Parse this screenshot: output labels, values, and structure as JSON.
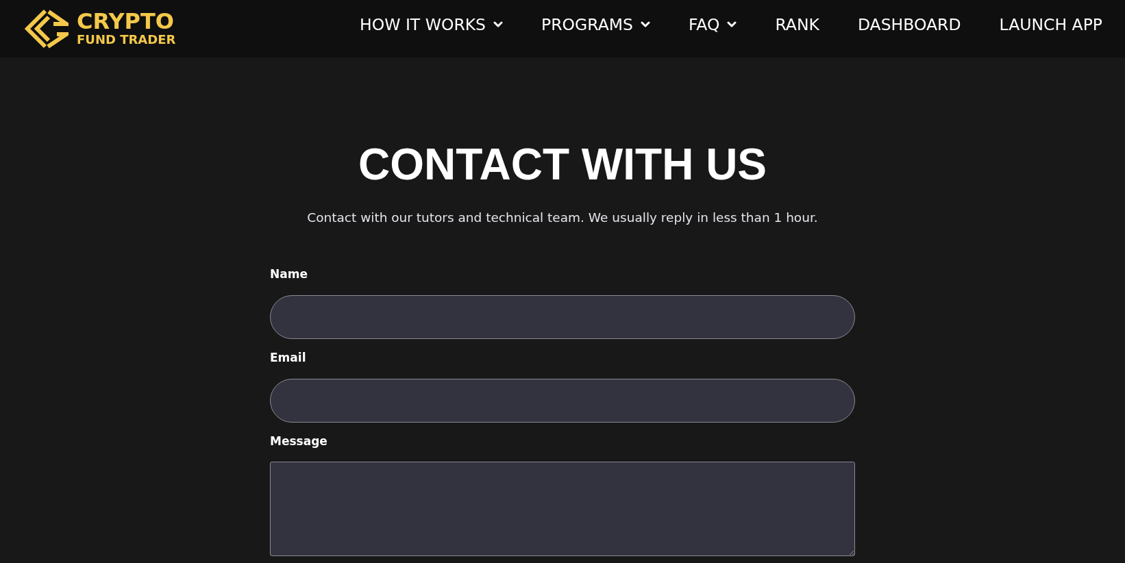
{
  "header": {
    "logo": {
      "line_1": "CRYPTO",
      "line_2": "FUND TRADER"
    },
    "nav": [
      {
        "label": "HOW IT WORKS",
        "dropdown": true
      },
      {
        "label": "PROGRAMS",
        "dropdown": true
      },
      {
        "label": "FAQ",
        "dropdown": true
      },
      {
        "label": "RANK",
        "dropdown": false
      },
      {
        "label": "DASHBOARD",
        "dropdown": false
      },
      {
        "label": "LAUNCH APP",
        "dropdown": false
      }
    ]
  },
  "hero": {
    "title": "CONTACT WITH US",
    "subtitle": "Contact with our tutors and technical team. We usually reply in less than 1 hour."
  },
  "form": {
    "fields": [
      {
        "label": "Name",
        "kind": "input"
      },
      {
        "label": "Email",
        "kind": "input"
      },
      {
        "label": "Message",
        "kind": "textarea"
      }
    ]
  }
}
